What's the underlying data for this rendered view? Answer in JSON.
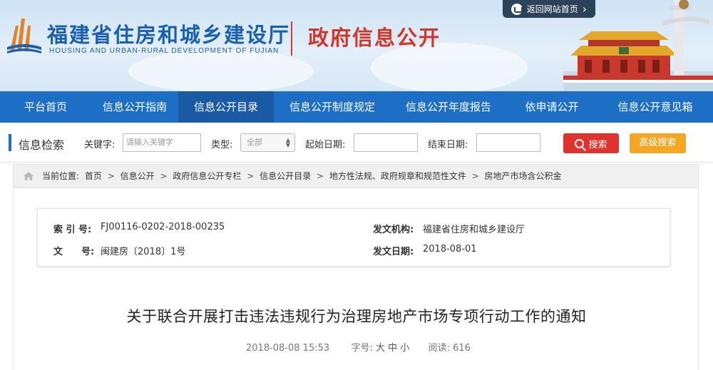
{
  "header": {
    "site_title": "福建省住房和城乡建设厅",
    "site_subtitle": "HOUSING AND URBAN-RURAL DEVELOPMENT OF FUJIAN",
    "section_title": "政府信息公开",
    "back_label": "返回网站首页",
    "back_arrow": "›"
  },
  "nav": {
    "items": [
      {
        "label": "平台首页"
      },
      {
        "label": "信息公开指南"
      },
      {
        "label": "信息公开目录"
      },
      {
        "label": "信息公开制度规定"
      },
      {
        "label": "信息公开年度报告"
      },
      {
        "label": "依申请公开"
      },
      {
        "label": "信息公开意见箱"
      }
    ],
    "active_index": 2
  },
  "search": {
    "title": "信息检索",
    "keyword_label": "关键字:",
    "keyword_placeholder": "请输入关键字",
    "type_label": "类型:",
    "type_value": "全部",
    "start_label": "起始日期:",
    "end_label": "结束日期:",
    "search_button": "搜索",
    "advanced_button": "高级搜索"
  },
  "breadcrumb": {
    "prefix": "当前位置:",
    "items": [
      "首页",
      "信息公开",
      "政府信息公开专栏",
      "信息公开目录",
      "地方性法规、政府规章和规范性文件",
      "房地产市场含公积金"
    ],
    "separator": ">"
  },
  "meta": {
    "index_label": "索 引 号:",
    "index_value": "FJ00116-0202-2018-00235",
    "doc_no_label": "文　　号:",
    "doc_no_value": "闽建房〔2018〕1号",
    "issuer_label": "发文机构:",
    "issuer_value": "福建省住房和城乡建设厅",
    "date_label": "发文日期:",
    "date_value": "2018-08-01"
  },
  "document": {
    "title": "关于联合开展打击违法违规行为治理房地产市场专项行动工作的通知",
    "datetime": "2018-08-08 15:53",
    "font_size_label": "字号:",
    "font_large": "大",
    "font_medium": "中",
    "font_small": "小",
    "reads_label": "阅读:",
    "reads_value": "616"
  },
  "colors": {
    "nav_bg": "#1d6fc6",
    "nav_active": "#1a5aa4",
    "search_button": "#e0322d",
    "advanced_button": "#f5a623",
    "title_blue": "#1b5fb0",
    "title_red": "#d0362a"
  }
}
